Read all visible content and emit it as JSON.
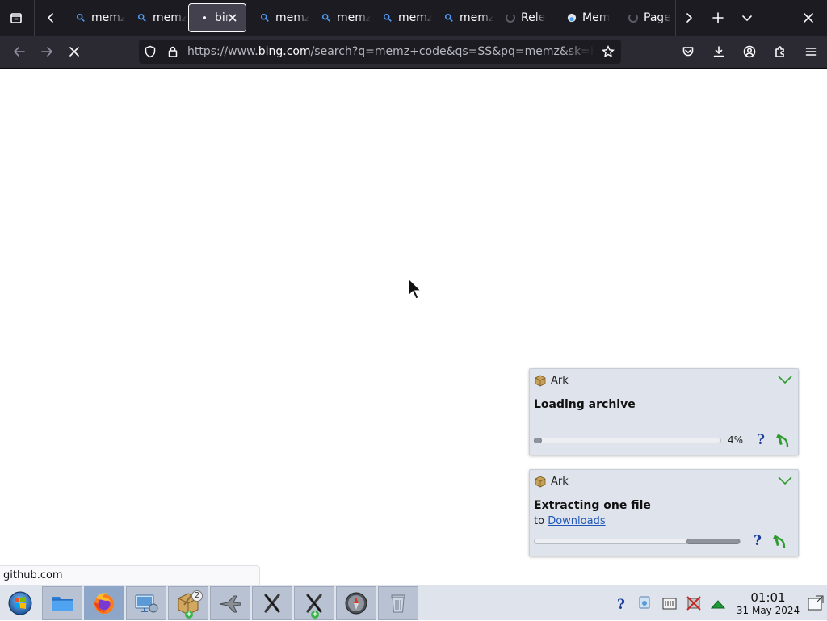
{
  "browser": {
    "tabs": [
      {
        "label": "memz",
        "icon": "search-icon",
        "active": false
      },
      {
        "label": "memz",
        "icon": "search-icon",
        "active": false
      },
      {
        "label": "bing",
        "icon": "loading-dot-icon",
        "active": true
      },
      {
        "label": "memz",
        "icon": "search-icon",
        "active": false
      },
      {
        "label": "memz",
        "icon": "search-icon",
        "active": false
      },
      {
        "label": "memz",
        "icon": "search-icon",
        "active": false
      },
      {
        "label": "memz",
        "icon": "search-icon",
        "active": false
      },
      {
        "label": "Rele",
        "icon": "github-icon",
        "active": false
      },
      {
        "label": "Mem",
        "icon": "github-icon",
        "active": false
      },
      {
        "label": "Page",
        "icon": "github-icon",
        "active": false
      }
    ],
    "url": {
      "prefix": "https://www.",
      "domain": "bing.com",
      "rest": "/search?q=memz+code&qs=SS&pq=memz&sk=HS"
    },
    "status_text": "github.com",
    "theme": {
      "tabbar_bg": "#1c1b22",
      "navbar_bg": "#2b2a33"
    }
  },
  "notifications": [
    {
      "app": "Ark",
      "title": "Loading archive",
      "subtitle": "",
      "progress_percent": 4,
      "progress_label": "4%"
    },
    {
      "app": "Ark",
      "title": "Extracting one file",
      "subtitle_prefix": "to",
      "subtitle_link": "Downloads",
      "progress_state": "indeterminate"
    }
  ],
  "taskbar": {
    "items": [
      {
        "name": "start-menu",
        "icon": "windows-orb-icon"
      },
      {
        "name": "file-manager",
        "icon": "folder-icon"
      },
      {
        "name": "firefox",
        "icon": "firefox-icon"
      },
      {
        "name": "system-settings",
        "icon": "monitor-settings-icon"
      },
      {
        "name": "ark",
        "icon": "ark-box-icon",
        "badge": "2"
      },
      {
        "name": "jet-app",
        "icon": "jet-icon"
      },
      {
        "name": "x-app-1",
        "icon": "x-icon"
      },
      {
        "name": "x-app-2",
        "icon": "x-icon"
      },
      {
        "name": "clock-app",
        "icon": "compass-icon"
      },
      {
        "name": "trash",
        "icon": "trash-icon"
      }
    ],
    "clock": {
      "time": "01:01",
      "date": "31 May 2024"
    }
  }
}
